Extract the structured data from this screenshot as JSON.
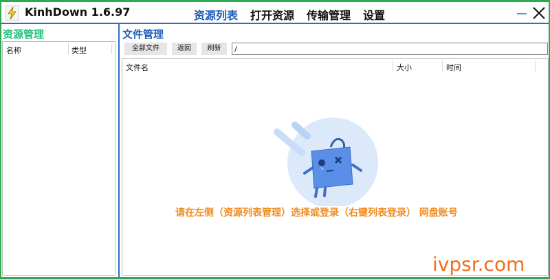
{
  "app": {
    "title": "KinhDown 1.6.97"
  },
  "nav": {
    "items": [
      {
        "label": "资源列表",
        "active": true
      },
      {
        "label": "打开资源",
        "active": false
      },
      {
        "label": "传输管理",
        "active": false
      },
      {
        "label": "设置",
        "active": false
      }
    ]
  },
  "window_controls": {
    "minimize_icon": "minus-icon",
    "close_icon": "close-x-icon"
  },
  "left_panel": {
    "title": "资源管理",
    "columns": [
      "名称",
      "类型"
    ]
  },
  "right_panel": {
    "title": "文件管理",
    "toolbar": {
      "all_files": "全部文件",
      "back": "返回",
      "refresh": "刷新"
    },
    "path": {
      "value": "/"
    },
    "columns": [
      "文件名",
      "大小",
      "时间"
    ],
    "empty_message": "请在左侧（资源列表管理）选择或登录（右键列表登录） 网盘账号"
  },
  "watermark": "ivpsr.com",
  "colors": {
    "frame": "#2fa84f",
    "accent_blue": "#1c5cb8",
    "left_title": "#1fc07a",
    "empty_message": "#f08c1e",
    "watermark": "#f26d1e"
  }
}
